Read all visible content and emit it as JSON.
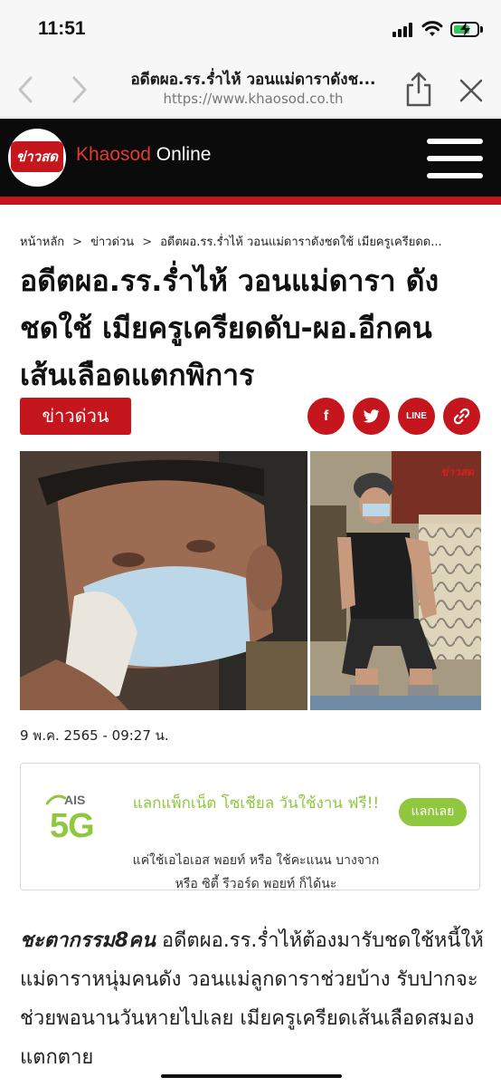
{
  "status_bar": {
    "time": "11:51"
  },
  "browser": {
    "page_title": "อดีตผอ.รร.ร่ำไห้ วอนแม่ดาราดังช...",
    "url": "https://www.khaosod.co.th"
  },
  "site": {
    "logo_text": "ข่าวสด",
    "brand_a": "Khaosod",
    "brand_b": "Online"
  },
  "breadcrumb": {
    "items": [
      "หน้าหลัก",
      "ข่าวด่วน",
      "อดีตผอ.รร.ร่ำไห้ วอนแม่ดาราดังชดใช้ เมียครูเครียดด..."
    ],
    "separator": ">"
  },
  "article": {
    "headline": "อดีตผอ.รร.ร่ำไห้ วอนแม่ดารา ดังชดใช้ เมียครูเครียดดับ-ผอ.อีกคนเส้นเลือดแตกพิการ",
    "tag": "ข่าวด่วน",
    "photo_watermark": "ข่าวสด",
    "date": "9 พ.ค. 2565 - 09:27 น.",
    "lead_bold": "ชะตากรรม8คน",
    "lead_text": " อดีตผอ.รร.ร่ำไห้ต้องมารับชดใช้หนี้ให้แม่ดาราหนุ่มคนดัง วอนแม่ลูกดาราช่วยบ้าง รับปากจะช่วยพอนานวันหายไปเลย เมียครูเครียดเส้นเลือดสมองแตกตาย"
  },
  "share": {
    "facebook": "f",
    "line": "LINE",
    "icons": [
      "facebook-icon",
      "twitter-icon",
      "line-icon",
      "link-icon"
    ]
  },
  "ad": {
    "logo_brand": "AIS",
    "logo_5g": "5G",
    "headline": "แลกแพ็กเน็ต โซเชียล วันใช้งาน ฟรี!!",
    "cta": "แลกเลย",
    "sub": "แค่ใช้เอไอเอส พอยท์ หรือ ใช้คะแนน บางจาก หรือ ซิตี้ รีวอร์ด พอยท์ ก็ได้นะ"
  },
  "colors": {
    "brand_red": "#c4161c",
    "header_bg": "#0b0b0b",
    "ad_green": "#8fc73e"
  }
}
